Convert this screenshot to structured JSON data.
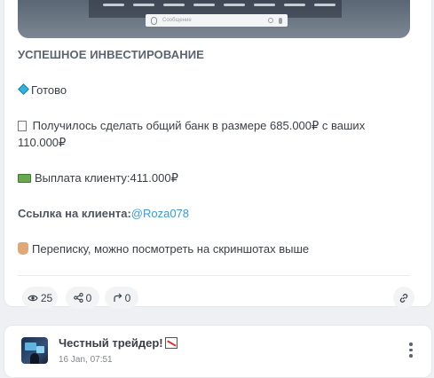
{
  "media": {
    "message_placeholder": "Сообщение"
  },
  "post": {
    "title": "УСПЕШНОЕ ИНВЕСТИРОВАНИЕ",
    "status": "Готово",
    "bank_text": "Получилось сделать общий банк в размере 685.000₽ с ваших 110.000₽",
    "payout_text": "Выплата клиенту:411.000₽",
    "client_link_label": "Ссылка на клиента:",
    "client_link_handle": "@Roza078",
    "screenshots_note": "Переписку, можно посмотреть на скриншотах выше"
  },
  "stats": {
    "views": "25",
    "shares": "0",
    "forwards": "0"
  },
  "next_post": {
    "channel_name": "Честный трейдер!",
    "time": "16 Jan, 07:51"
  },
  "colors": {
    "link": "#3a9ad9",
    "card_bg": "#ffffff",
    "page_bg": "#eef0f3"
  },
  "icons": [
    "eye-icon",
    "share-icon",
    "forward-icon",
    "link-icon",
    "more-vertical-icon"
  ]
}
